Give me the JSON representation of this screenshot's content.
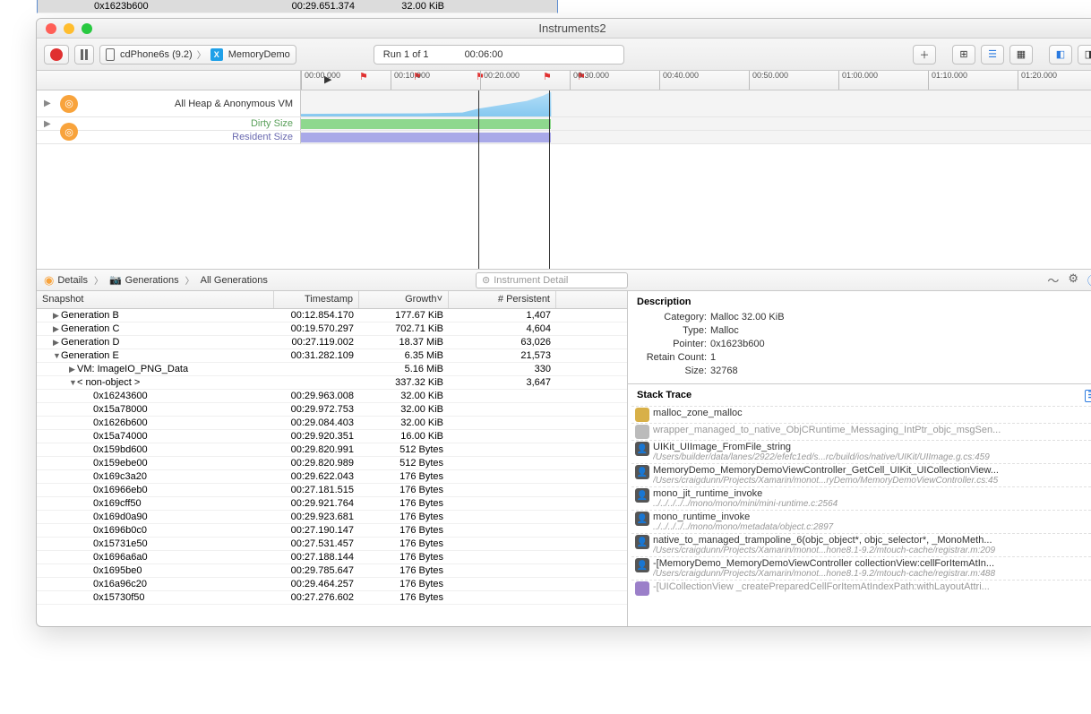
{
  "window": {
    "title": "Instruments2"
  },
  "toolbar": {
    "target": "cdPhone6s (9.2)",
    "app": "MemoryDemo",
    "run_label": "Run 1 of 1",
    "time": "00:06:00"
  },
  "ruler": {
    "ticks": [
      "00:00.000",
      "00:10.000",
      "00:20.000",
      "00:30.000",
      "00:40.000",
      "00:50.000",
      "01:00.000",
      "01:10.000",
      "01:20.000"
    ]
  },
  "tracks": {
    "heap": "All Heap & Anonymous VM",
    "dirty": "Dirty Size",
    "resident": "Resident Size"
  },
  "detailbar": {
    "details": "Details",
    "gen": "Generations",
    "allgen": "All Generations",
    "search_ph": "Instrument Detail"
  },
  "table": {
    "cols": {
      "snap": "Snapshot",
      "ts": "Timestamp",
      "gr": "Growth",
      "pr": "# Persistent"
    },
    "rows": [
      {
        "indent": 1,
        "tri": "▶",
        "label": "Generation B",
        "ts": "00:12.854.170",
        "gr": "177.67 KiB",
        "pr": "1,407"
      },
      {
        "indent": 1,
        "tri": "▶",
        "label": "Generation C",
        "ts": "00:19.570.297",
        "gr": "702.71 KiB",
        "pr": "4,604"
      },
      {
        "indent": 1,
        "tri": "▶",
        "label": "Generation D",
        "ts": "00:27.119.002",
        "gr": "18.37 MiB",
        "pr": "63,026"
      },
      {
        "indent": 1,
        "tri": "▼",
        "label": "Generation E",
        "ts": "00:31.282.109",
        "gr": "6.35 MiB",
        "pr": "21,573"
      },
      {
        "indent": 2,
        "tri": "▶",
        "label": "VM: ImageIO_PNG_Data",
        "ts": "",
        "gr": "5.16 MiB",
        "pr": "330"
      },
      {
        "indent": 2,
        "tri": "▼",
        "label": "< non-object >",
        "ts": "",
        "gr": "337.32 KiB",
        "pr": "3,647"
      },
      {
        "indent": 3,
        "tri": "",
        "label": "0x1623b600",
        "ts": "00:29.651.374",
        "gr": "32.00 KiB",
        "pr": "",
        "sel": true
      },
      {
        "indent": 3,
        "tri": "",
        "label": "0x16243600",
        "ts": "00:29.963.008",
        "gr": "32.00 KiB",
        "pr": ""
      },
      {
        "indent": 3,
        "tri": "",
        "label": "0x15a78000",
        "ts": "00:29.972.753",
        "gr": "32.00 KiB",
        "pr": ""
      },
      {
        "indent": 3,
        "tri": "",
        "label": "0x1626b600",
        "ts": "00:29.084.403",
        "gr": "32.00 KiB",
        "pr": ""
      },
      {
        "indent": 3,
        "tri": "",
        "label": "0x15a74000",
        "ts": "00:29.920.351",
        "gr": "16.00 KiB",
        "pr": ""
      },
      {
        "indent": 3,
        "tri": "",
        "label": "0x159bd600",
        "ts": "00:29.820.991",
        "gr": "512 Bytes",
        "pr": ""
      },
      {
        "indent": 3,
        "tri": "",
        "label": "0x159ebe00",
        "ts": "00:29.820.989",
        "gr": "512 Bytes",
        "pr": ""
      },
      {
        "indent": 3,
        "tri": "",
        "label": "0x169c3a20",
        "ts": "00:29.622.043",
        "gr": "176 Bytes",
        "pr": ""
      },
      {
        "indent": 3,
        "tri": "",
        "label": "0x16966eb0",
        "ts": "00:27.181.515",
        "gr": "176 Bytes",
        "pr": ""
      },
      {
        "indent": 3,
        "tri": "",
        "label": "0x169cff50",
        "ts": "00:29.921.764",
        "gr": "176 Bytes",
        "pr": ""
      },
      {
        "indent": 3,
        "tri": "",
        "label": "0x169d0a90",
        "ts": "00:29.923.681",
        "gr": "176 Bytes",
        "pr": ""
      },
      {
        "indent": 3,
        "tri": "",
        "label": "0x1696b0c0",
        "ts": "00:27.190.147",
        "gr": "176 Bytes",
        "pr": ""
      },
      {
        "indent": 3,
        "tri": "",
        "label": "0x15731e50",
        "ts": "00:27.531.457",
        "gr": "176 Bytes",
        "pr": ""
      },
      {
        "indent": 3,
        "tri": "",
        "label": "0x1696a6a0",
        "ts": "00:27.188.144",
        "gr": "176 Bytes",
        "pr": ""
      },
      {
        "indent": 3,
        "tri": "",
        "label": "0x1695be0",
        "ts": "00:29.785.647",
        "gr": "176 Bytes",
        "pr": ""
      },
      {
        "indent": 3,
        "tri": "",
        "label": "0x16a96c20",
        "ts": "00:29.464.257",
        "gr": "176 Bytes",
        "pr": ""
      },
      {
        "indent": 3,
        "tri": "",
        "label": "0x15730f50",
        "ts": "00:27.276.602",
        "gr": "176 Bytes",
        "pr": ""
      }
    ]
  },
  "desc": {
    "title": "Description",
    "rows": [
      {
        "k": "Category:",
        "v": "Malloc 32.00 KiB"
      },
      {
        "k": "Type:",
        "v": "Malloc"
      },
      {
        "k": "Pointer:",
        "v": "0x1623b600"
      },
      {
        "k": "Retain Count:",
        "v": "1"
      },
      {
        "k": "Size:",
        "v": "32768"
      }
    ]
  },
  "stack": {
    "title": "Stack Trace",
    "rows": [
      {
        "icon": "sys",
        "func": "malloc_zone_malloc",
        "path": ""
      },
      {
        "icon": "gray",
        "func": "wrapper_managed_to_native_ObjCRuntime_Messaging_IntPtr_objc_msgSen...",
        "path": "",
        "dim": true
      },
      {
        "icon": "user",
        "func": "UIKit_UIImage_FromFile_string",
        "path": "/Users/builder/data/lanes/2922/efefc1ed/s...rc/build/ios/native/UIKit/UIImage.g.cs:459"
      },
      {
        "icon": "user",
        "func": "MemoryDemo_MemoryDemoViewController_GetCell_UIKit_UICollectionView...",
        "path": "/Users/craigdunn/Projects/Xamarin/monot...ryDemo/MemoryDemoViewController.cs:45"
      },
      {
        "icon": "user",
        "func": "mono_jit_runtime_invoke",
        "path": "../../../../../mono/mono/mini/mini-runtime.c:2564"
      },
      {
        "icon": "user",
        "func": "mono_runtime_invoke",
        "path": "../../../../../mono/mono/metadata/object.c:2897"
      },
      {
        "icon": "user",
        "func": "native_to_managed_trampoline_6(objc_object*, objc_selector*, _MonoMeth...",
        "path": "/Users/craigdunn/Projects/Xamarin/monot...hone8.1-9.2/mtouch-cache/registrar.m:209"
      },
      {
        "icon": "user",
        "func": "-[MemoryDemo_MemoryDemoViewController collectionView:cellForItemAtIn...",
        "path": "/Users/craigdunn/Projects/Xamarin/monot...hone8.1-9.2/mtouch-cache/registrar.m:488"
      },
      {
        "icon": "purple",
        "func": "-[UICollectionView _createPreparedCellForItemAtIndexPath:withLayoutAttri...",
        "path": "",
        "dim": true
      }
    ]
  }
}
